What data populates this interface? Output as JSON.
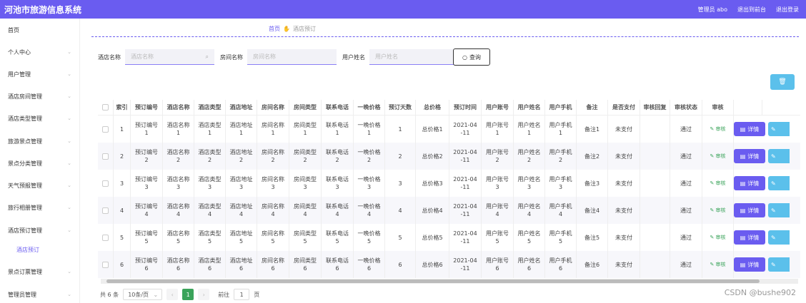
{
  "header": {
    "app_title": "河池市旅游信息系统",
    "admin": "管理员 abo",
    "to_front": "退出到前台",
    "logout": "退出登录"
  },
  "sidebar": {
    "items": [
      {
        "label": "首页",
        "chevron": false
      },
      {
        "label": "个人中心",
        "chevron": true
      },
      {
        "label": "用户管理",
        "chevron": true
      },
      {
        "label": "酒店房间管理",
        "chevron": true
      },
      {
        "label": "酒店类型管理",
        "chevron": true
      },
      {
        "label": "旅游景点管理",
        "chevron": true
      },
      {
        "label": "景点分类管理",
        "chevron": true
      },
      {
        "label": "天气预报管理",
        "chevron": true
      },
      {
        "label": "旅行相册管理",
        "chevron": true
      },
      {
        "label": "酒店预订管理",
        "chevron": true
      },
      {
        "label": "景点订票管理",
        "chevron": true
      },
      {
        "label": "管理员管理",
        "chevron": true
      }
    ],
    "sub_item": "酒店预订"
  },
  "breadcrumb": {
    "home": "首页",
    "current": "酒店预订"
  },
  "search": {
    "hotel_label": "酒店名称",
    "hotel_placeholder": "酒店名称",
    "room_label": "房间名称",
    "room_placeholder": "房间名称",
    "user_label": "用户姓名",
    "user_placeholder": "用户姓名",
    "query_label": "查询"
  },
  "table": {
    "headers": [
      "",
      "索引",
      "预订编号",
      "酒店名称",
      "酒店类型",
      "酒店地址",
      "房间名称",
      "房间类型",
      "联系电话",
      "一晚价格",
      "预订天数",
      "总价格",
      "预订时间",
      "用户账号",
      "用户姓名",
      "用户手机",
      "备注",
      "是否支付",
      "审核回复",
      "审核状态",
      "审核",
      ""
    ],
    "rows": [
      [
        "",
        "1",
        "预订编号\n1",
        "酒店名称\n1",
        "酒店类型\n1",
        "酒店地址\n1",
        "房间名称\n1",
        "房间类型\n1",
        "联系电话\n1",
        "一晚价格\n1",
        "1",
        "总价格1",
        "2021-04\n-11",
        "用户账号\n1",
        "用户姓名\n1",
        "用户手机\n1",
        "备注1",
        "未支付",
        "",
        "通过",
        "审核",
        ""
      ],
      [
        "",
        "2",
        "预订编号\n2",
        "酒店名称\n2",
        "酒店类型\n2",
        "酒店地址\n2",
        "房间名称\n2",
        "房间类型\n2",
        "联系电话\n2",
        "一晚价格\n2",
        "2",
        "总价格2",
        "2021-04\n-11",
        "用户账号\n2",
        "用户姓名\n2",
        "用户手机\n2",
        "备注2",
        "未支付",
        "",
        "通过",
        "审核",
        ""
      ],
      [
        "",
        "3",
        "预订编号\n3",
        "酒店名称\n3",
        "酒店类型\n3",
        "酒店地址\n3",
        "房间名称\n3",
        "房间类型\n3",
        "联系电话\n3",
        "一晚价格\n3",
        "3",
        "总价格3",
        "2021-04\n-11",
        "用户账号\n3",
        "用户姓名\n3",
        "用户手机\n3",
        "备注3",
        "未支付",
        "",
        "通过",
        "审核",
        ""
      ],
      [
        "",
        "4",
        "预订编号\n4",
        "酒店名称\n4",
        "酒店类型\n4",
        "酒店地址\n4",
        "房间名称\n4",
        "房间类型\n4",
        "联系电话\n4",
        "一晚价格\n4",
        "4",
        "总价格4",
        "2021-04\n-11",
        "用户账号\n4",
        "用户姓名\n4",
        "用户手机\n4",
        "备注4",
        "未支付",
        "",
        "通过",
        "审核",
        ""
      ],
      [
        "",
        "5",
        "预订编号\n5",
        "酒店名称\n5",
        "酒店类型\n5",
        "酒店地址\n5",
        "房间名称\n5",
        "房间类型\n5",
        "联系电话\n5",
        "一晚价格\n5",
        "5",
        "总价格5",
        "2021-04\n-11",
        "用户账号\n5",
        "用户姓名\n5",
        "用户手机\n5",
        "备注5",
        "未支付",
        "",
        "通过",
        "审核",
        ""
      ],
      [
        "",
        "6",
        "预订编号\n6",
        "酒店名称\n6",
        "酒店类型\n6",
        "酒店地址\n6",
        "房间名称\n6",
        "房间类型\n6",
        "联系电话\n6",
        "一晚价格\n6",
        "6",
        "总价格6",
        "2021-04\n-11",
        "用户账号\n6",
        "用户姓名\n6",
        "用户手机\n6",
        "备注6",
        "未支付",
        "",
        "通过",
        "审核",
        ""
      ]
    ],
    "detail_label": "详情"
  },
  "pagination": {
    "total": "共 6 条",
    "page_size": "10条/页",
    "current_page": "1",
    "goto_label": "前往",
    "goto_value": "1",
    "page_unit": "页"
  },
  "watermark": "CSDN @bushe902",
  "colors": {
    "primary": "#6a5cf0",
    "info": "#5bc0eb",
    "success": "#3aa35a"
  }
}
